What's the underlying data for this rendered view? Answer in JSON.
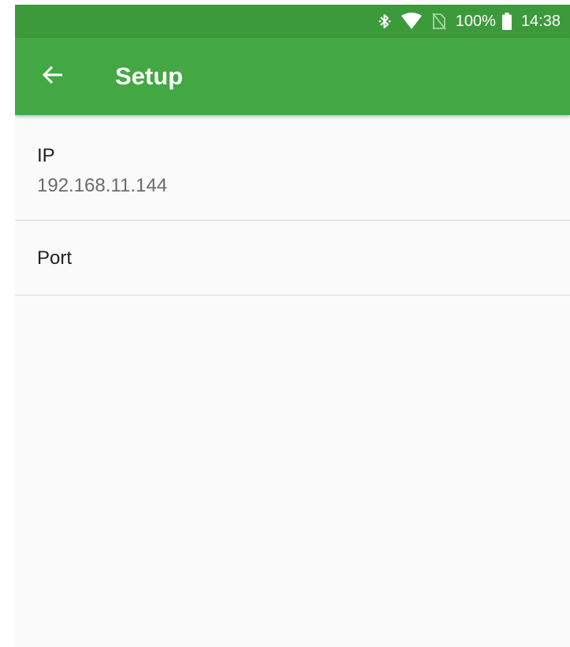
{
  "status_bar": {
    "battery_level": "100%",
    "time": "14:38",
    "icons": [
      "bluetooth-icon",
      "wifi-icon",
      "no-sim-icon",
      "battery-icon"
    ]
  },
  "app_bar": {
    "title": "Setup",
    "back_icon": "arrow-back-icon",
    "color": "#43a843"
  },
  "preferences": [
    {
      "title": "IP",
      "summary": "192.168.11.144"
    },
    {
      "title": "Port",
      "summary": ""
    }
  ],
  "colors": {
    "status_bar": "#3c9a3b",
    "app_bar": "#43a843",
    "background": "#fafafa",
    "divider": "#d9d9d9"
  }
}
